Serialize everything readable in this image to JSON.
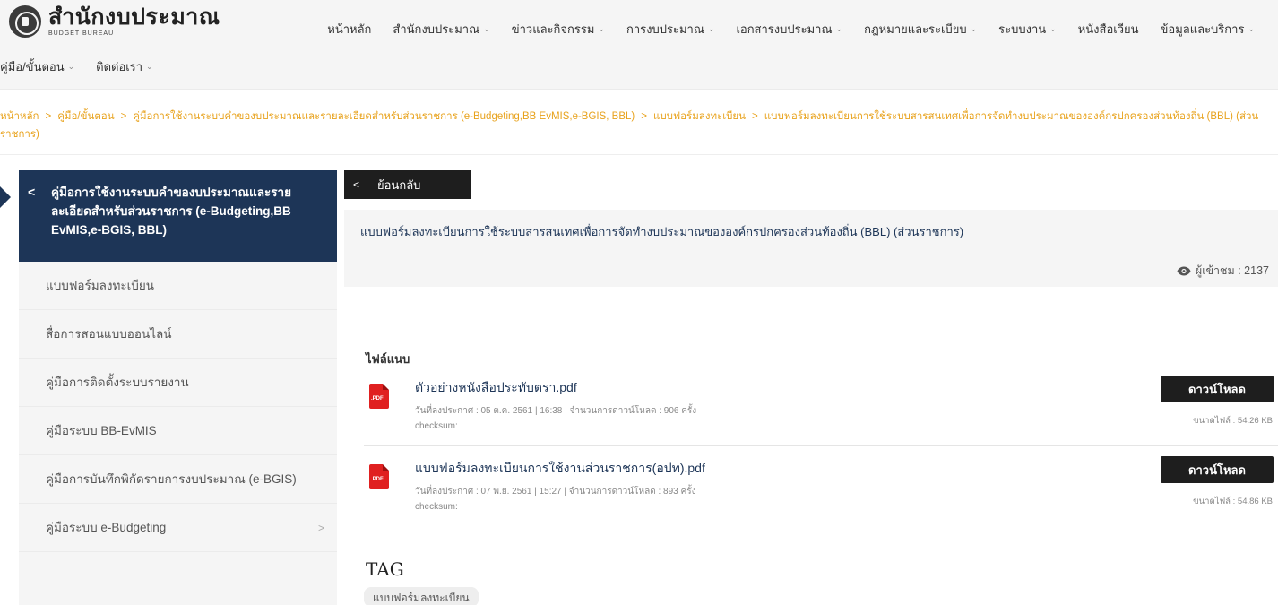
{
  "header": {
    "logo_th": "สำนักงบประมาณ",
    "logo_en": "BUDGET BUREAU",
    "nav_row1": [
      {
        "label": "หน้าหลัก",
        "dropdown": false
      },
      {
        "label": "สำนักงบประมาณ",
        "dropdown": true
      },
      {
        "label": "ข่าวและกิจกรรม",
        "dropdown": true
      },
      {
        "label": "การงบประมาณ",
        "dropdown": true
      },
      {
        "label": "เอกสารงบประมาณ",
        "dropdown": true
      },
      {
        "label": "กฎหมายและระเบียบ",
        "dropdown": true
      },
      {
        "label": "ระบบงาน",
        "dropdown": true
      },
      {
        "label": "หนังสือเวียน",
        "dropdown": false
      },
      {
        "label": "ข้อมูลและบริการ",
        "dropdown": true
      }
    ],
    "nav_row2": [
      {
        "label": "คู่มือ/ขั้นตอน",
        "dropdown": true
      },
      {
        "label": "ติดต่อเรา",
        "dropdown": true
      }
    ]
  },
  "breadcrumb": [
    "หน้าหลัก",
    "คู่มือ/ขั้นตอน",
    "คู่มือการใช้งานระบบคำของบประมาณและรายละเอียดสำหรับส่วนราชการ (e-Budgeting,BB EvMIS,e-BGIS, BBL)",
    "แบบฟอร์มลงทะเบียน",
    "แบบฟอร์มลงทะเบียนการใช้ระบบสารสนเทศเพื่อการจัดทำงบประมาณขององค์กรปกครองส่วนท้องถิ่น (BBL) (ส่วนราชการ)"
  ],
  "sidebar": {
    "heading": "คู่มือการใช้งานระบบคำของบประมาณและรายละเอียดสำหรับส่วนราชการ (e-Budgeting,BB EvMIS,e-BGIS, BBL)",
    "items": [
      {
        "label": "แบบฟอร์มลงทะเบียน",
        "has_children": false
      },
      {
        "label": "สื่อการสอนแบบออนไลน์",
        "has_children": false
      },
      {
        "label": "คู่มือการติดตั้งระบบรายงาน",
        "has_children": false
      },
      {
        "label": "คู่มือระบบ BB-EvMIS",
        "has_children": false
      },
      {
        "label": "คู่มือการบันทึกพิกัดรายการงบประมาณ (e-BGIS)",
        "has_children": false
      },
      {
        "label": "คู่มือระบบ e-Budgeting",
        "has_children": true
      }
    ]
  },
  "main": {
    "back_label": "ย้อนกลับ",
    "doc_title": "แบบฟอร์มลงทะเบียนการใช้ระบบสารสนเทศเพื่อการจัดทำงบประมาณขององค์กรปกครองส่วนท้องถิ่น (BBL) (ส่วนราชการ)",
    "viewer_text": "ผู้เข้าชม : 2137",
    "attachments_title": "ไฟล์แนบ",
    "files": [
      {
        "name": "ตัวอย่างหนังสือประทับตรา.pdf",
        "meta": "วันที่ลงประกาศ : 05 ต.ค. 2561  |  16:38  |  จำนวนการดาวน์โหลด : 906 ครั้ง",
        "checksum": "checksum:",
        "download_label": "ดาวน์โหลด",
        "size": "ขนาดไฟล์ : 54.26 KB"
      },
      {
        "name": "แบบฟอร์มลงทะเบียนการใช้งานส่วนราชการ(อปท).pdf",
        "meta": "วันที่ลงประกาศ : 07 พ.ย. 2561  |  15:27  |  จำนวนการดาวน์โหลด : 893 ครั้ง",
        "checksum": "checksum:",
        "download_label": "ดาวน์โหลด",
        "size": "ขนาดไฟล์ : 54.86 KB"
      }
    ],
    "tag_title": "TAG",
    "tags": [
      "แบบฟอร์มลงทะเบียน"
    ]
  },
  "colors": {
    "navy": "#1d3557",
    "breadcrumb_orange": "#e8a21c",
    "button_black": "#1e1e1e",
    "pdf_red": "#e02020"
  },
  "icons": {
    "logo": "budget-bureau-seal",
    "file": "pdf-file-icon",
    "viewer": "eye-icon",
    "back": "chevron-left-icon",
    "expand": "chevron-right-icon",
    "dropdown": "chevron-down-icon"
  }
}
